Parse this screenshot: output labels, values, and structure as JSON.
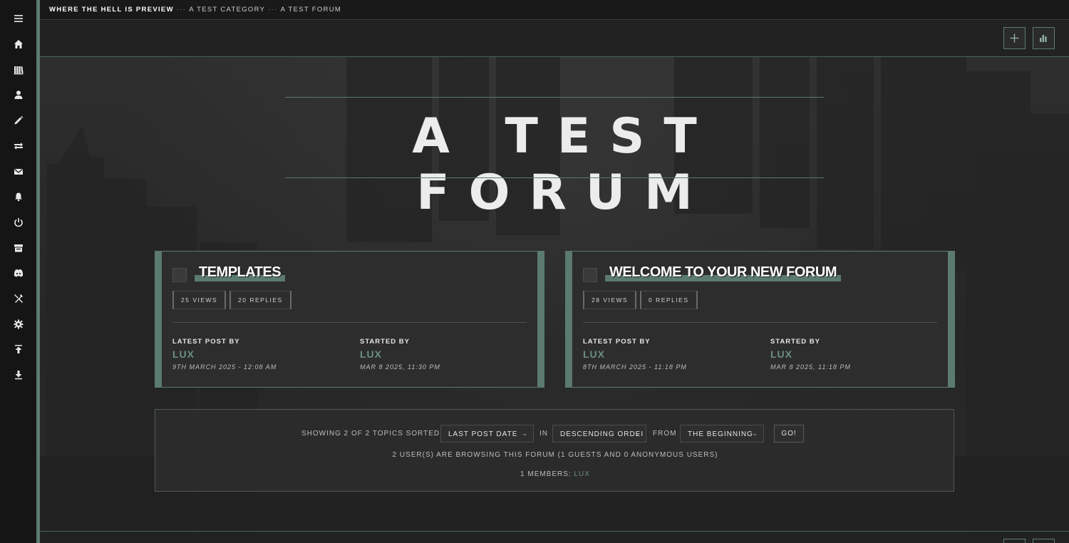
{
  "breadcrumb": {
    "home": "WHERE THE HELL IS PREVIEW",
    "separator": "···",
    "category": "A TEST CATEGORY",
    "forum": "A TEST FORUM"
  },
  "sidebar": {
    "icons": [
      "menu-icon",
      "home-icon",
      "library-icon",
      "user-icon",
      "pencil-icon",
      "swap-icon",
      "mail-icon",
      "bell-icon",
      "power-icon",
      "store-icon",
      "discord-icon",
      "tools-icon",
      "gear-icon",
      "upload-icon",
      "download-icon"
    ]
  },
  "toolbar": {
    "new_topic_icon": "plus-icon",
    "stats_icon": "bar-chart-icon"
  },
  "hero": {
    "title": "A TEST FORUM"
  },
  "topics": [
    {
      "title": "TEMPLATES",
      "views": "25 VIEWS",
      "replies": "20 REPLIES",
      "latest_label": "LATEST POST BY",
      "latest_user": "LUX",
      "latest_date": "9TH MARCH 2025 - 12:08 AM",
      "started_label": "STARTED BY",
      "started_user": "LUX",
      "started_date": "MAR 8 2025, 11:30 PM"
    },
    {
      "title": "WELCOME TO YOUR NEW FORUM",
      "views": "28 VIEWS",
      "replies": "0 REPLIES",
      "latest_label": "LATEST POST BY",
      "latest_user": "LUX",
      "latest_date": "8TH MARCH 2025 - 11:18 PM",
      "started_label": "STARTED BY",
      "started_user": "LUX",
      "started_date": "MAR 8 2025, 11:18 PM"
    }
  ],
  "sort": {
    "showing": "SHOWING 2 OF 2 TOPICS SORTED BY",
    "sort_by": "LAST POST DATE",
    "in_label": "IN",
    "order": "DESCENDING ORDEI",
    "from_label": "FROM",
    "from": "THE BEGINNING",
    "go": "GO!"
  },
  "browsing": "2 USER(S) ARE BROWSING THIS FORUM (1 GUESTS AND 0 ANONYMOUS USERS)",
  "members": {
    "prefix": "1 MEMBERS:",
    "user": "LUX"
  },
  "colors": {
    "accent": "#5b7a70",
    "link": "#6b8f83",
    "background": "#1c1c1c"
  }
}
